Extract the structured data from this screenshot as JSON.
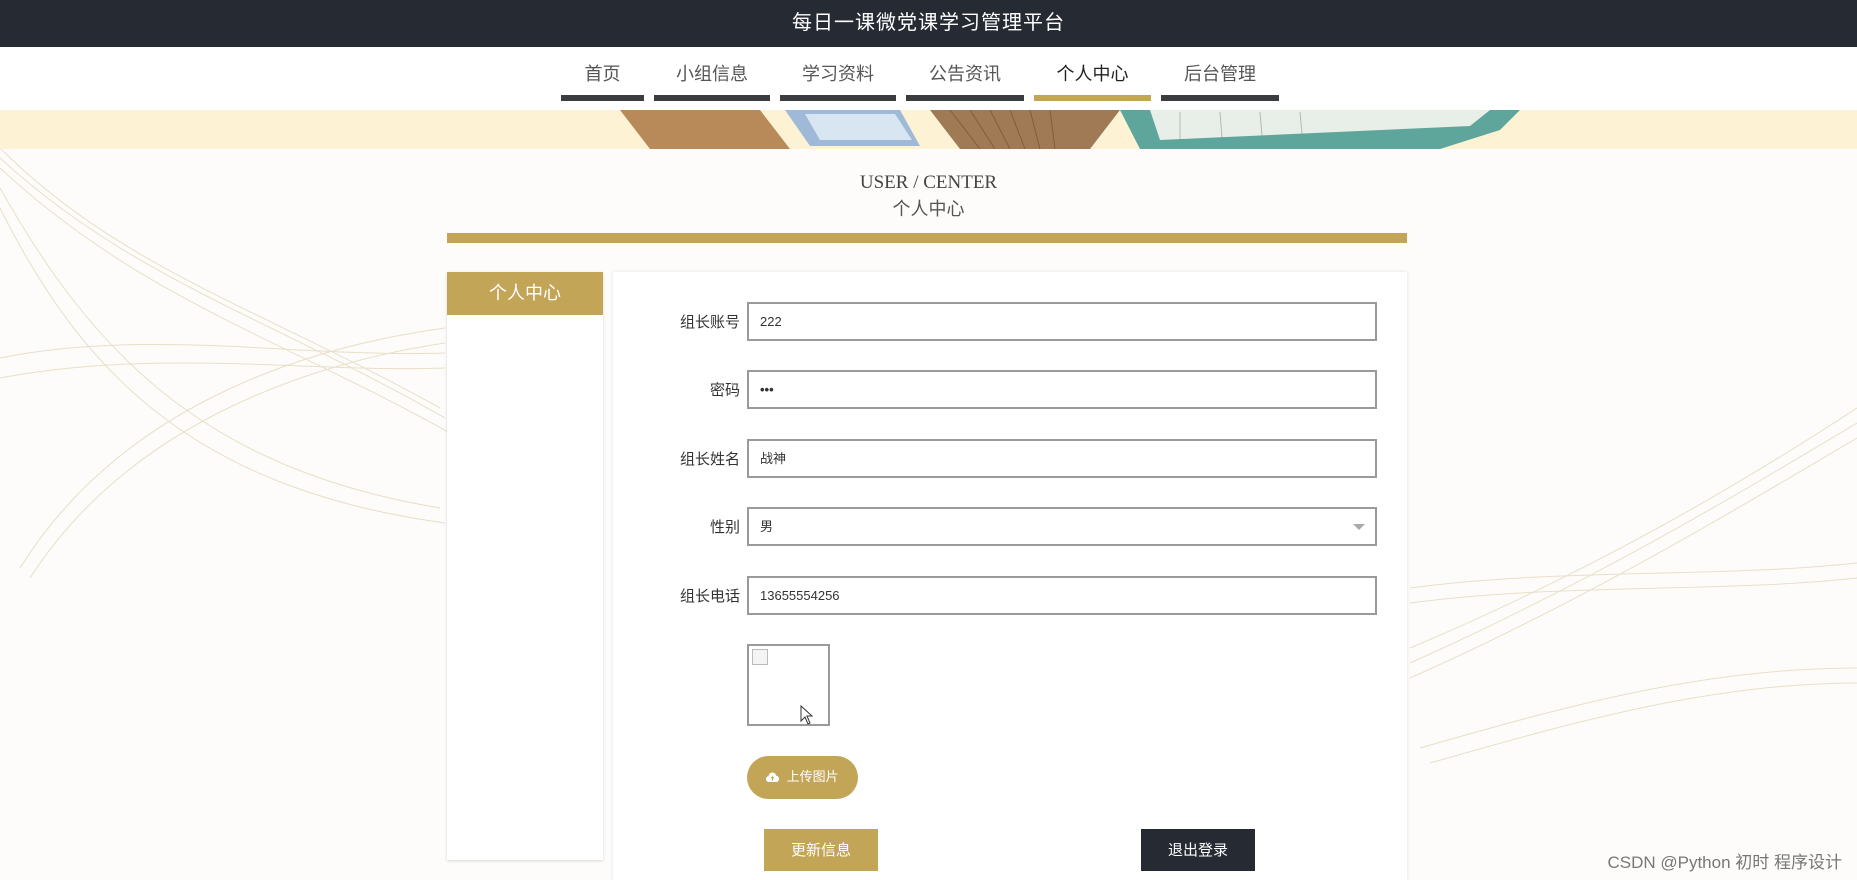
{
  "header": {
    "title": "每日一课微党课学习管理平台"
  },
  "nav": {
    "items": [
      {
        "label": "首页",
        "active": false
      },
      {
        "label": "小组信息",
        "active": false
      },
      {
        "label": "学习资料",
        "active": false
      },
      {
        "label": "公告资讯",
        "active": false
      },
      {
        "label": "个人中心",
        "active": true
      },
      {
        "label": "后台管理",
        "active": false
      }
    ]
  },
  "page_heading": {
    "en": "USER / CENTER",
    "cn": "个人中心"
  },
  "sidebar": {
    "title": "个人中心"
  },
  "form": {
    "account": {
      "label": "组长账号",
      "value": "222"
    },
    "password": {
      "label": "密码",
      "value": "•••"
    },
    "name": {
      "label": "组长姓名",
      "value": "战神"
    },
    "gender": {
      "label": "性别",
      "value": "男"
    },
    "phone": {
      "label": "组长电话",
      "value": "13655554256"
    }
  },
  "buttons": {
    "upload": "上传图片",
    "update": "更新信息",
    "logout": "退出登录"
  },
  "watermark": "CSDN @Python 初时 程序设计",
  "colors": {
    "accent": "#c3a558",
    "dark": "#262a33",
    "banner": "#fdf2d4"
  }
}
